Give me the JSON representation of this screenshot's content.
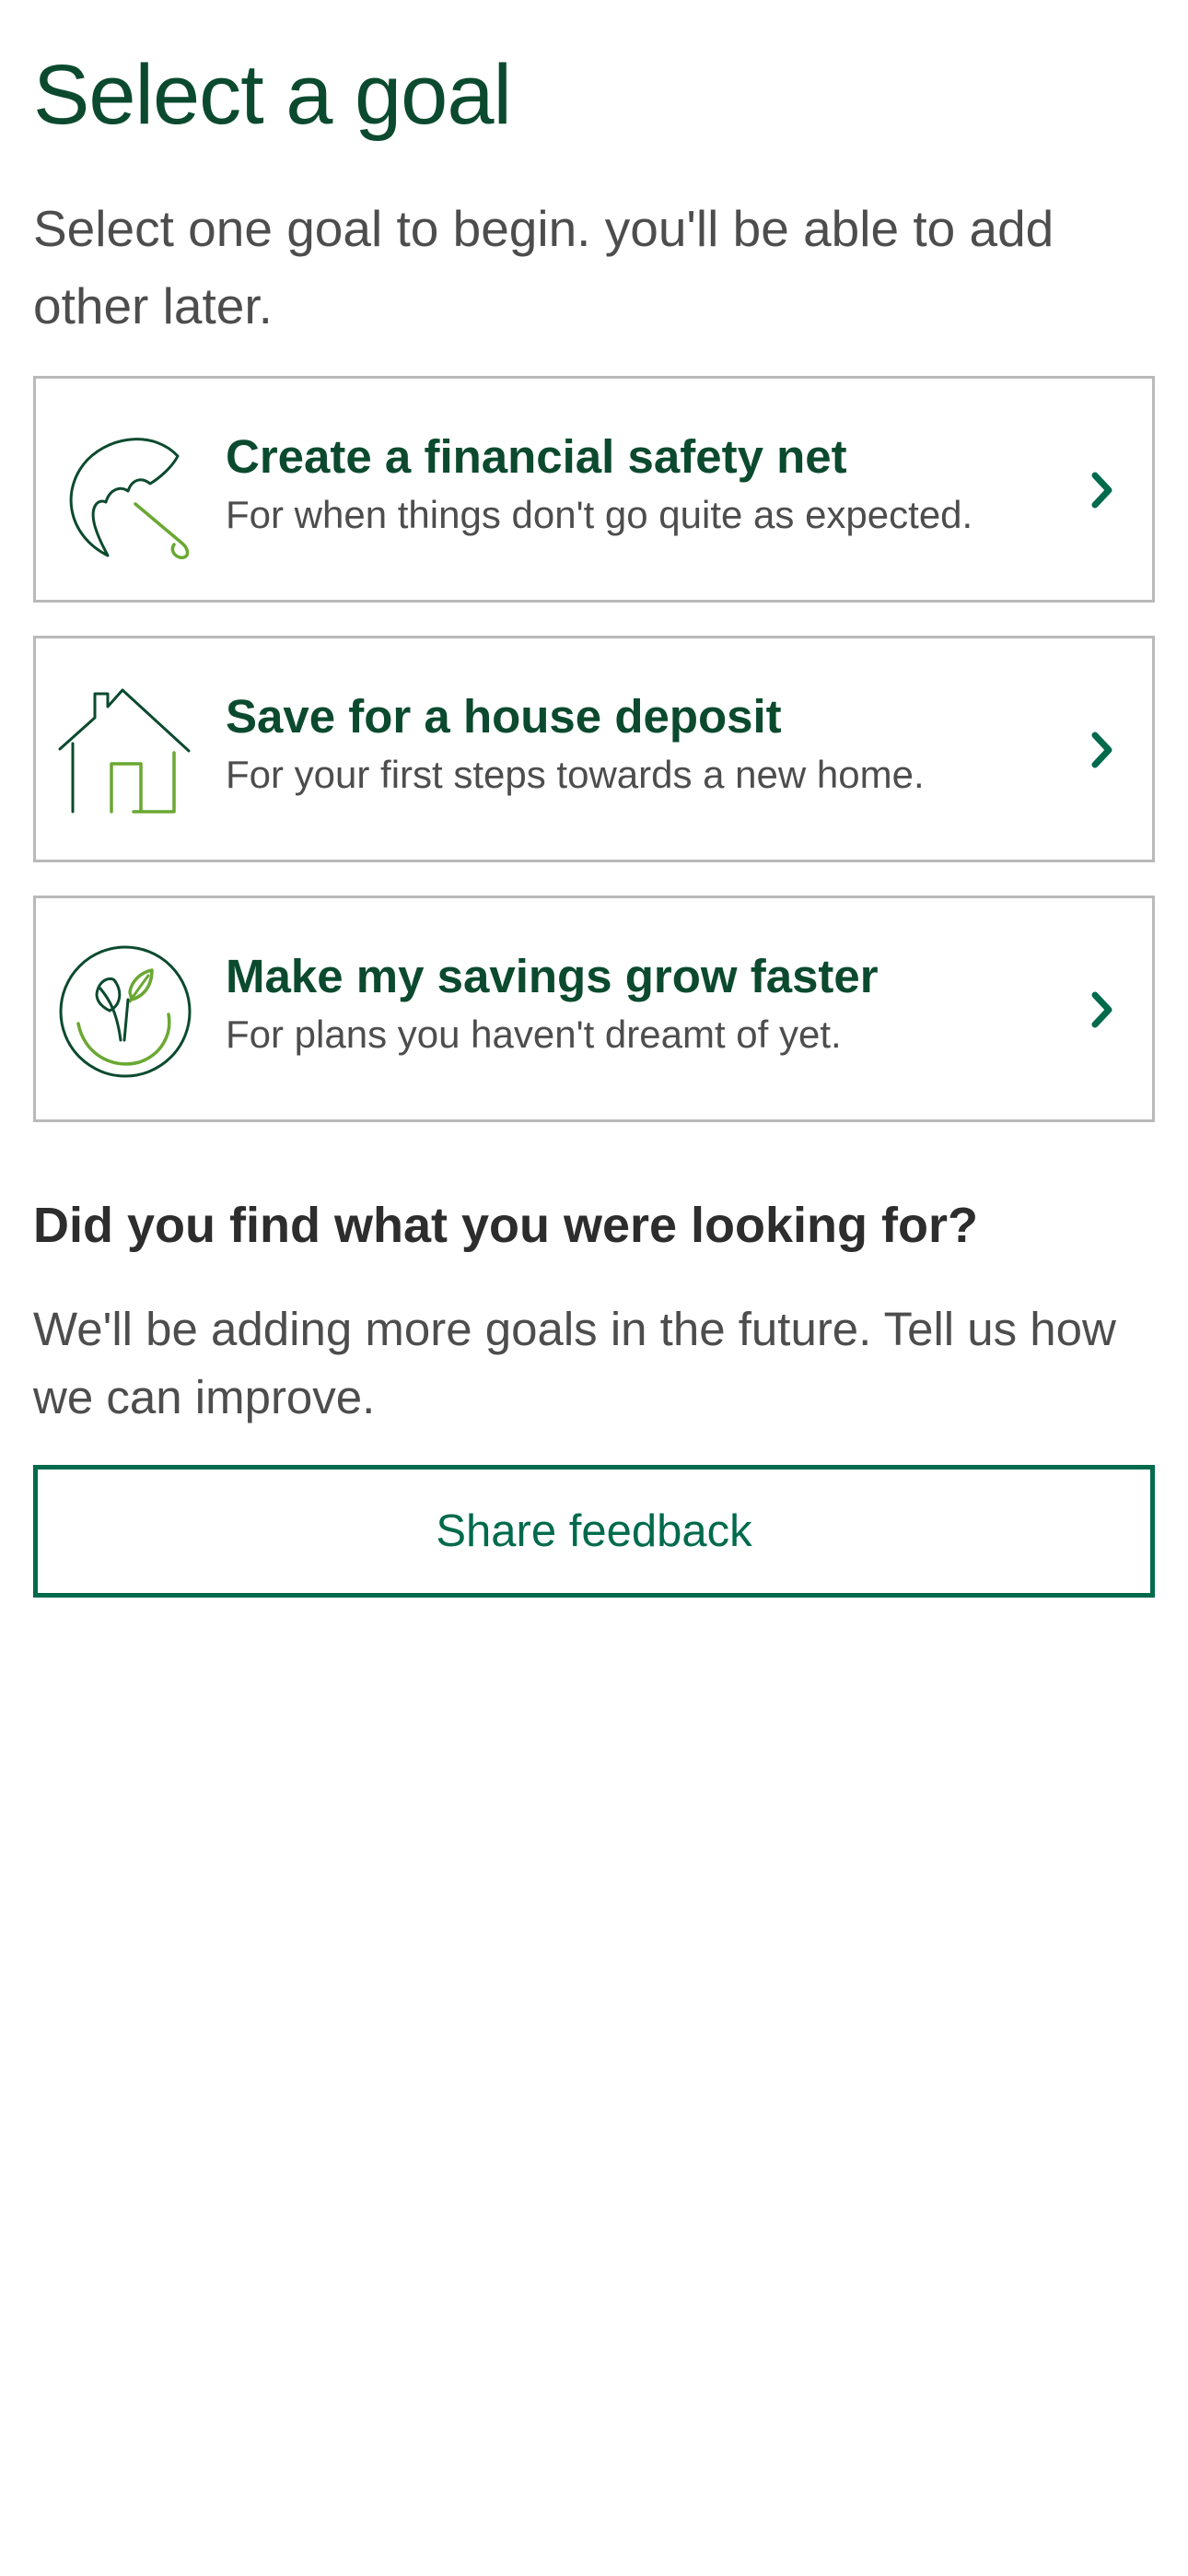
{
  "header": {
    "title": "Select a goal",
    "intro": "Select one goal to begin. you'll be able to add other later."
  },
  "goals": [
    {
      "title": "Create a financial safety net",
      "description": "For when things don't go quite as expected.",
      "icon": "umbrella-icon"
    },
    {
      "title": "Save for a house deposit",
      "description": "For your first steps towards a new home.",
      "icon": "house-icon"
    },
    {
      "title": "Make my savings grow faster",
      "description": "For plans you haven't dreamt of yet.",
      "icon": "growing-plant-icon"
    }
  ],
  "feedback": {
    "heading": "Did you find what you were looking for?",
    "text": "We'll be adding more goals in the future. Tell us how we can improve.",
    "button_label": "Share feedback"
  },
  "colors": {
    "brand_dark_green": "#0b4a2e",
    "accent_green": "#006a4d",
    "light_green": "#6aa832",
    "body_text": "#4d4d4d",
    "card_border": "#b9b9b9"
  }
}
